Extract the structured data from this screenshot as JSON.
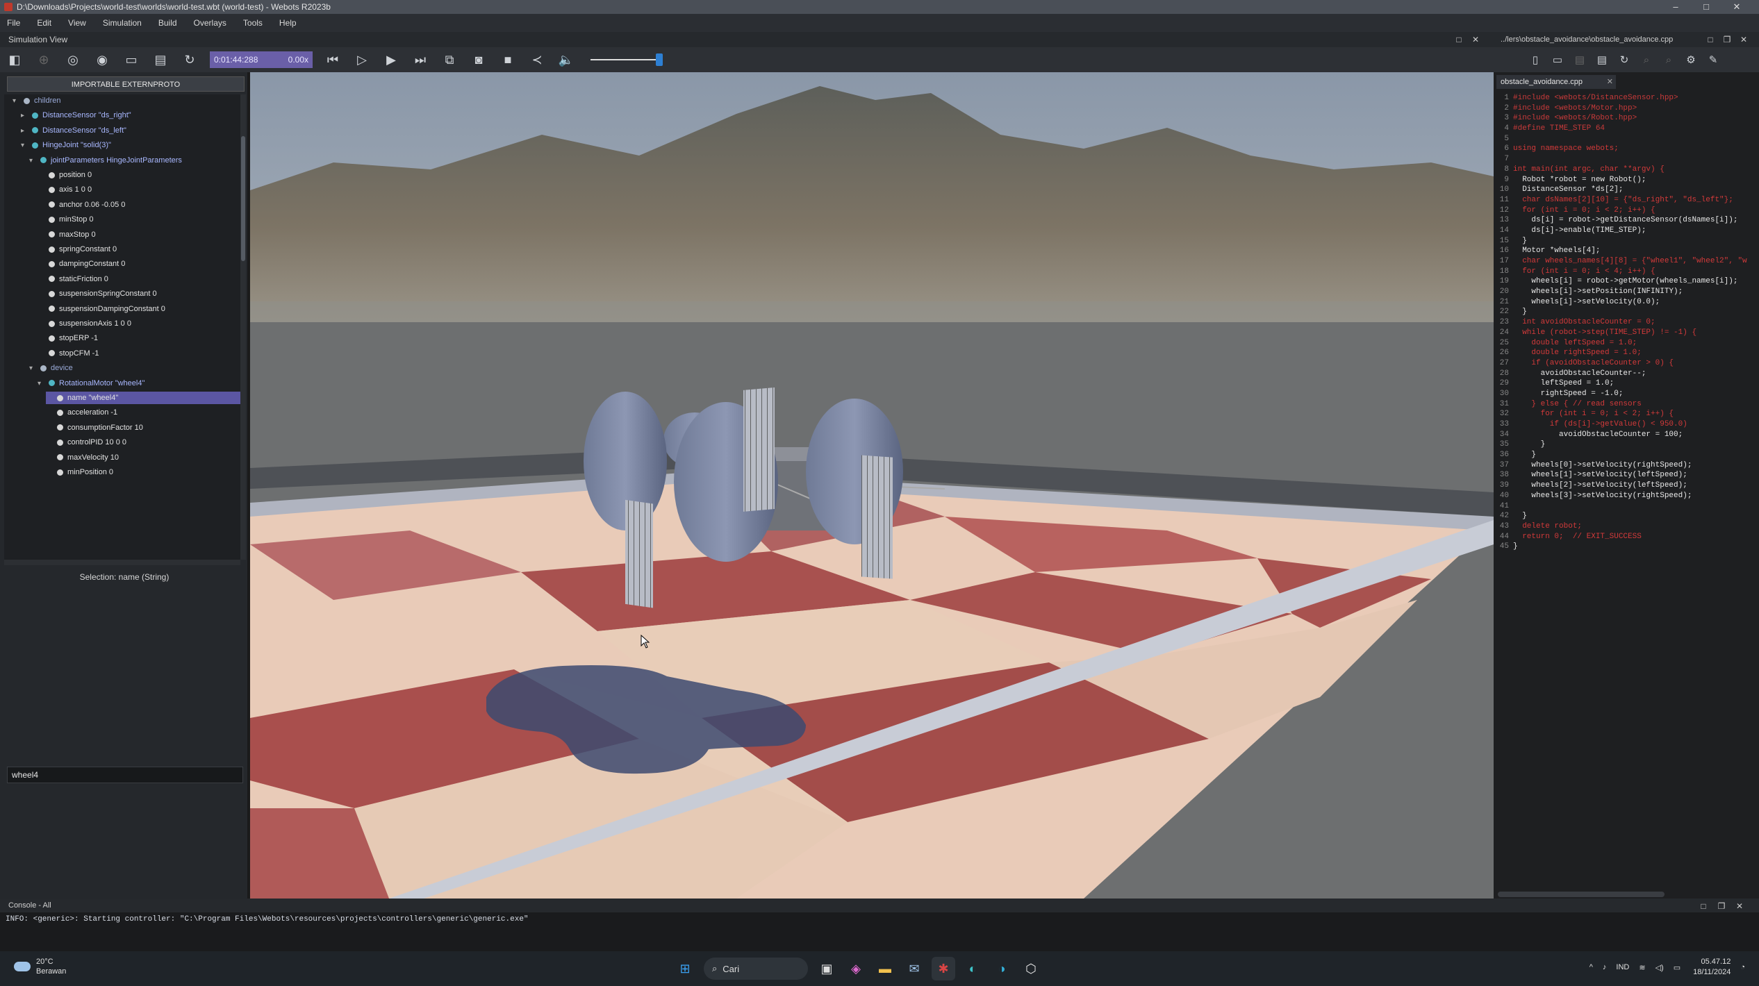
{
  "window": {
    "title": "D:\\Downloads\\Projects\\world-test\\worlds\\world-test.wbt (world-test) - Webots R2023b"
  },
  "menu": [
    "File",
    "Edit",
    "View",
    "Simulation",
    "Build",
    "Overlays",
    "Tools",
    "Help"
  ],
  "simulation_view": {
    "title": "Simulation View"
  },
  "toolbar": {
    "time": "0:01:44:288",
    "speed": "0.00x"
  },
  "code_editor": {
    "path": "../lers\\obstacle_avoidance\\obstacle_avoidance.cpp",
    "tab": "obstacle_avoidance.cpp",
    "lines": [
      "#include <webots/DistanceSensor.hpp>",
      "#include <webots/Motor.hpp>",
      "#include <webots/Robot.hpp>",
      "#define TIME_STEP 64",
      "",
      "using namespace webots;",
      "",
      "int main(int argc, char **argv) {",
      "  Robot *robot = new Robot();",
      "  DistanceSensor *ds[2];",
      "  char dsNames[2][10] = {\"ds_right\", \"ds_left\"};",
      "  for (int i = 0; i < 2; i++) {",
      "    ds[i] = robot->getDistanceSensor(dsNames[i]);",
      "    ds[i]->enable(TIME_STEP);",
      "  }",
      "  Motor *wheels[4];",
      "  char wheels_names[4][8] = {\"wheel1\", \"wheel2\", \"w",
      "  for (int i = 0; i < 4; i++) {",
      "    wheels[i] = robot->getMotor(wheels_names[i]);",
      "    wheels[i]->setPosition(INFINITY);",
      "    wheels[i]->setVelocity(0.0);",
      "  }",
      "  int avoidObstacleCounter = 0;",
      "  while (robot->step(TIME_STEP) != -1) {",
      "    double leftSpeed = 1.0;",
      "    double rightSpeed = 1.0;",
      "    if (avoidObstacleCounter > 0) {",
      "      avoidObstacleCounter--;",
      "      leftSpeed = 1.0;",
      "      rightSpeed = -1.0;",
      "    } else { // read sensors",
      "      for (int i = 0; i < 2; i++) {",
      "        if (ds[i]->getValue() < 950.0)",
      "          avoidObstacleCounter = 100;",
      "      }",
      "    }",
      "    wheels[0]->setVelocity(rightSpeed);",
      "    wheels[1]->setVelocity(leftSpeed);",
      "    wheels[2]->setVelocity(leftSpeed);",
      "    wheels[3]->setVelocity(rightSpeed);",
      "",
      "  }",
      "  delete robot;",
      "  return 0;  // EXIT_SUCCESS",
      "}"
    ]
  },
  "scene_tree": {
    "proto_button": "IMPORTABLE EXTERNPROTO",
    "nodes": [
      {
        "label": "children",
        "arrow": "▾",
        "color": "#aab6c6"
      },
      {
        "label": "DistanceSensor \"ds_right\"",
        "arrow": "▸",
        "color": "#4fb6c4"
      },
      {
        "label": "DistanceSensor \"ds_left\"",
        "arrow": "▸",
        "color": "#4fb6c4"
      },
      {
        "label": "HingeJoint \"solid(3)\"",
        "arrow": "▾",
        "color": "#4fb6c4"
      },
      {
        "label": "jointParameters HingeJointParameters",
        "arrow": "▾",
        "color": "#4fb6c4"
      },
      {
        "label": "position 0",
        "arrow": "",
        "color": "#d8d8d8"
      },
      {
        "label": "axis 1 0 0",
        "arrow": "",
        "color": "#d8d8d8"
      },
      {
        "label": "anchor 0.06 -0.05 0",
        "arrow": "",
        "color": "#d8d8d8"
      },
      {
        "label": "minStop 0",
        "arrow": "",
        "color": "#d8d8d8"
      },
      {
        "label": "maxStop 0",
        "arrow": "",
        "color": "#d8d8d8"
      },
      {
        "label": "springConstant 0",
        "arrow": "",
        "color": "#d8d8d8"
      },
      {
        "label": "dampingConstant 0",
        "arrow": "",
        "color": "#d8d8d8"
      },
      {
        "label": "staticFriction 0",
        "arrow": "",
        "color": "#d8d8d8"
      },
      {
        "label": "suspensionSpringConstant 0",
        "arrow": "",
        "color": "#d8d8d8"
      },
      {
        "label": "suspensionDampingConstant 0",
        "arrow": "",
        "color": "#d8d8d8"
      },
      {
        "label": "suspensionAxis 1 0 0",
        "arrow": "",
        "color": "#d8d8d8"
      },
      {
        "label": "stopERP -1",
        "arrow": "",
        "color": "#d8d8d8"
      },
      {
        "label": "stopCFM -1",
        "arrow": "",
        "color": "#d8d8d8"
      },
      {
        "label": "device",
        "arrow": "▾",
        "color": "#aab6c6"
      },
      {
        "label": "RotationalMotor \"wheel4\"",
        "arrow": "▾",
        "color": "#4fb6c4"
      },
      {
        "label": "name \"wheel4\"",
        "arrow": "",
        "color": "#d8d8d8"
      },
      {
        "label": "acceleration -1",
        "arrow": "",
        "color": "#d8d8d8"
      },
      {
        "label": "consumptionFactor 10",
        "arrow": "",
        "color": "#d8d8d8"
      },
      {
        "label": "controlPID 10 0 0",
        "arrow": "",
        "color": "#d8d8d8"
      },
      {
        "label": "maxVelocity 10",
        "arrow": "",
        "color": "#d8d8d8"
      },
      {
        "label": "minPosition 0",
        "arrow": "",
        "color": "#d8d8d8"
      }
    ]
  },
  "selection_label": "Selection: name (String)",
  "field_value": "wheel4",
  "console": {
    "title": "Console - All",
    "line": "INFO: <generic>: Starting controller: \"C:\\Program Files\\Webots\\resources\\projects\\controllers\\generic\\generic.exe\""
  },
  "taskbar": {
    "temperature": "20°C",
    "weather": "Berawan",
    "search": "Cari",
    "lang": "IND",
    "time": "05.47.12",
    "date": "18/11/2024"
  },
  "colors": {
    "accent": "#6a5fa8",
    "selection": "#5b56a3",
    "slider": "#2d7fd3"
  }
}
